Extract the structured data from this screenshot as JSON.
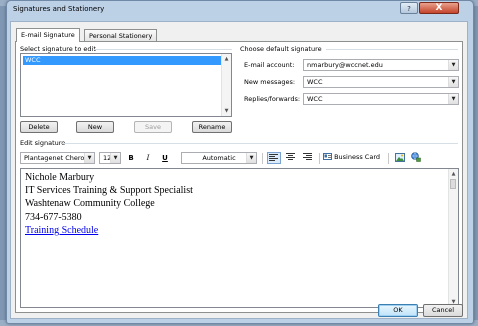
{
  "window": {
    "title": "Signatures and Stationery",
    "help_glyph": "?",
    "close_glyph": "X"
  },
  "tabs": [
    {
      "label": "E-mail Signature",
      "active": true
    },
    {
      "label": "Personal Stationery",
      "active": false
    }
  ],
  "select_signature": {
    "label": "Select signature to edit",
    "items": [
      "WCC"
    ],
    "selected": "WCC"
  },
  "buttons": {
    "delete": "Delete",
    "new": "New",
    "save": "Save",
    "rename": "Rename",
    "business_card": "Business Card",
    "ok": "OK",
    "cancel": "Cancel"
  },
  "default_signature": {
    "label": "Choose default signature",
    "email_account_label": "E-mail account:",
    "email_account_value": "nmarbury@wccnet.edu",
    "new_messages_label": "New messages:",
    "new_messages_value": "WCC",
    "replies_label": "Replies/forwards:",
    "replies_value": "WCC"
  },
  "edit_signature": {
    "label": "Edit signature",
    "font": "Plantagenet Cherol",
    "size": "12",
    "bold": "B",
    "italic": "I",
    "underline": "U",
    "color": "Automatic"
  },
  "signature_text": {
    "name": "Nichole Marbury",
    "title": "IT Services Training & Support Specialist",
    "org": "Washtenaw Community College",
    "phone": "734-677-5380",
    "link": "Training Schedule"
  },
  "colors": {
    "selection": "#3399ff",
    "link": "#0000ee",
    "close_button": "#c4442b"
  }
}
